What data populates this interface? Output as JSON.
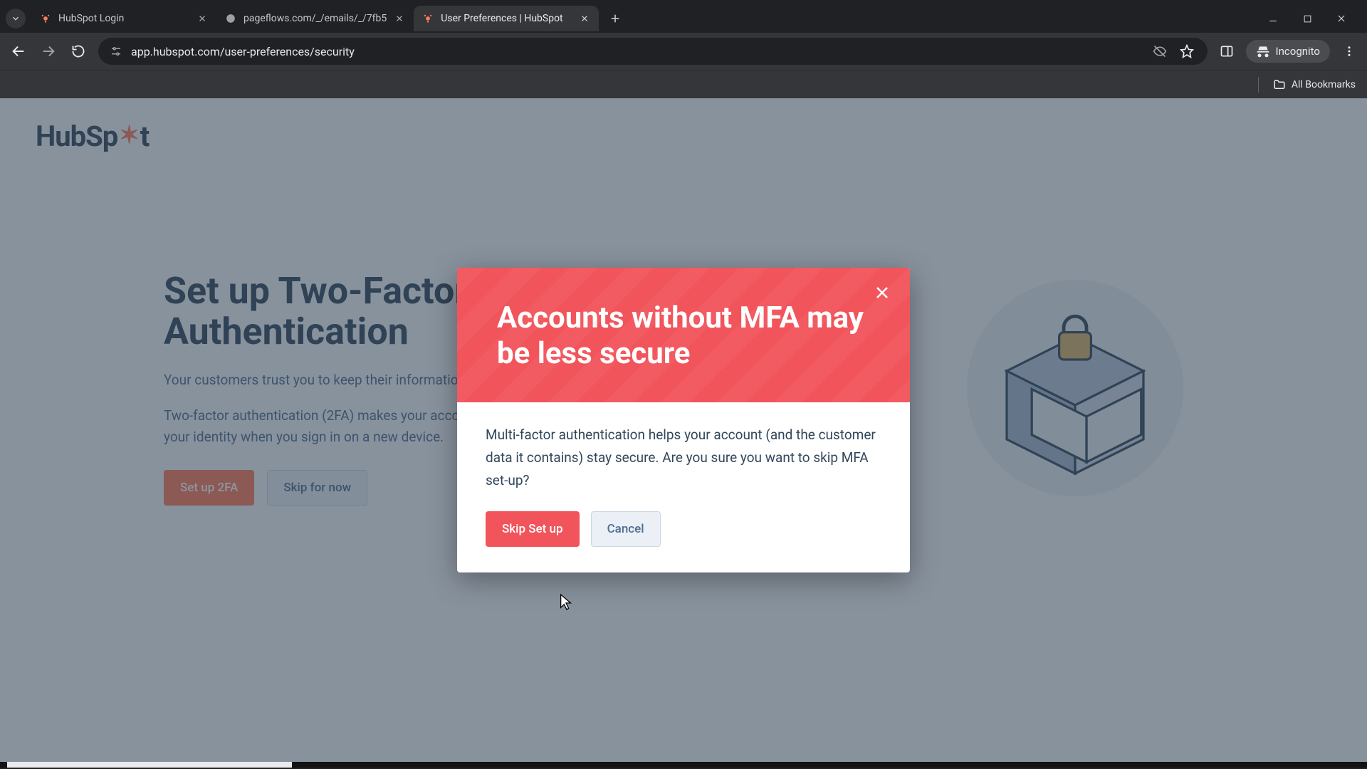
{
  "browser": {
    "tabs": [
      {
        "title": "HubSpot Login",
        "active": false,
        "favicon": "hubspot"
      },
      {
        "title": "pageflows.com/_/emails/_/7fb5",
        "active": false,
        "favicon": "generic"
      },
      {
        "title": "User Preferences | HubSpot",
        "active": true,
        "favicon": "hubspot"
      }
    ],
    "url": "app.hubspot.com/user-preferences/security",
    "incognito_label": "Incognito",
    "all_bookmarks_label": "All Bookmarks"
  },
  "page": {
    "brand": "HubSpot",
    "heading": "Set up Two-Factor Authentication",
    "paragraph1": "Your customers trust you to keep their information safe.",
    "paragraph2": "Two-factor authentication (2FA) makes your account more secure by verifying your identity when you sign in on a new device.",
    "primary_button": "Set up 2FA",
    "secondary_button": "Skip for now"
  },
  "modal": {
    "title": "Accounts without MFA may be less secure",
    "body": "Multi-factor authentication helps your account (and the customer data it contains) stay secure. Are you sure you want to skip MFA set-up?",
    "confirm": "Skip Set up",
    "cancel": "Cancel"
  },
  "colors": {
    "accent": "#ff7a59",
    "danger": "#f2545b",
    "text": "#33475b"
  }
}
